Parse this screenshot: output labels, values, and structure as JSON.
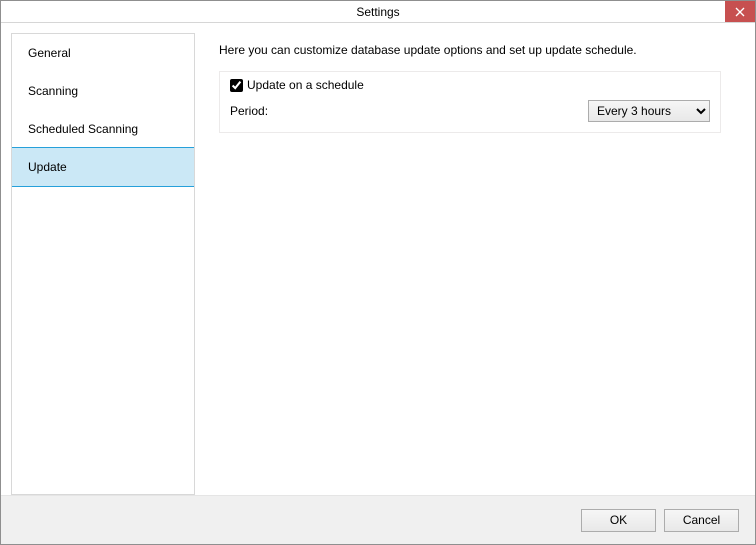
{
  "window": {
    "title": "Settings"
  },
  "sidebar": {
    "items": [
      {
        "label": "General"
      },
      {
        "label": "Scanning"
      },
      {
        "label": "Scheduled Scanning"
      },
      {
        "label": "Update"
      }
    ],
    "active_index": 3
  },
  "content": {
    "description": "Here you can customize database update options and set up update schedule.",
    "schedule": {
      "checkbox_label": "Update on a schedule",
      "checked": true,
      "period_label": "Period:",
      "period_value": "Every 3 hours"
    }
  },
  "footer": {
    "ok_label": "OK",
    "cancel_label": "Cancel"
  }
}
